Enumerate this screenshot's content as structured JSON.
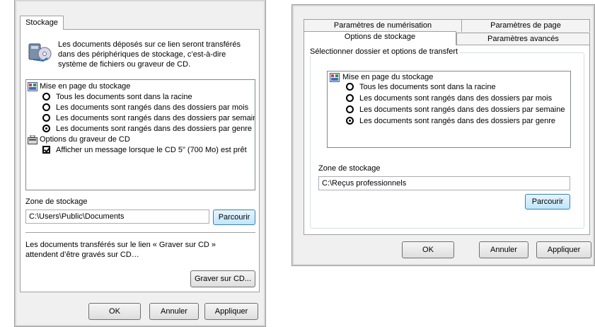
{
  "left_dialog": {
    "tab_label": "Stockage",
    "description": [
      "Les documents déposés sur ce lien seront transférés",
      "dans des périphériques de stockage, c’est-à-dire",
      "système de fichiers ou graveur de CD."
    ],
    "tree": {
      "layout_header": "Mise en page du stockage",
      "options": [
        {
          "label": "Tous les documents sont dans la racine",
          "selected": false
        },
        {
          "label": "Les documents sont rangés dans des dossiers par mois",
          "selected": false
        },
        {
          "label": "Les documents sont rangés dans des dossiers par semaine",
          "selected": false
        },
        {
          "label": "Les documents sont rangés dans des dossiers par genre",
          "selected": true
        }
      ],
      "cd_header": "Options du graveur de CD",
      "cd_option": {
        "label": "Afficher un message lorsque le CD 5\" (700 Mo) est prêt",
        "checked": true
      }
    },
    "storage_label": "Zone de stockage",
    "storage_path": "C:\\Users\\Public\\Documents",
    "browse_label": "Parcourir",
    "burn_note": [
      "Les documents transférés sur le lien « Graver sur CD »",
      "attendent d’être gravés sur CD…"
    ],
    "burn_button": "Graver sur CD...",
    "ok": "OK",
    "cancel": "Annuler",
    "apply": "Appliquer"
  },
  "right_dialog": {
    "tabs_back": [
      "Paramètres de numérisation",
      "Paramètres de page"
    ],
    "tabs_front": [
      "Options de stockage",
      "Paramètres avancés"
    ],
    "group_label": "Sélectionner dossier et options de transfert",
    "tree": {
      "layout_header": "Mise en page du stockage",
      "options": [
        {
          "label": "Tous les documents sont dans la racine",
          "selected": false
        },
        {
          "label": "Les documents sont rangés dans des dossiers par mois",
          "selected": false
        },
        {
          "label": "Les documents sont rangés dans des dossiers par semaine",
          "selected": false
        },
        {
          "label": "Les documents sont rangés dans des dossiers par genre",
          "selected": true
        }
      ]
    },
    "storage_label": "Zone de stockage",
    "storage_path": "C:\\Reçus professionnels",
    "browse_label": "Parcourir",
    "ok": "OK",
    "cancel": "Annuler",
    "apply": "Appliquer"
  }
}
